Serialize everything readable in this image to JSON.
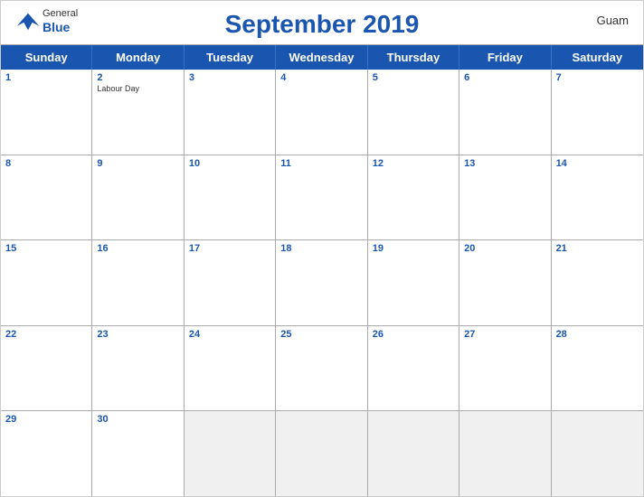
{
  "header": {
    "title": "September 2019",
    "region": "Guam",
    "logo_general": "General",
    "logo_blue": "Blue"
  },
  "day_headers": [
    "Sunday",
    "Monday",
    "Tuesday",
    "Wednesday",
    "Thursday",
    "Friday",
    "Saturday"
  ],
  "weeks": [
    [
      {
        "num": "1",
        "holiday": ""
      },
      {
        "num": "2",
        "holiday": "Labour Day"
      },
      {
        "num": "3",
        "holiday": ""
      },
      {
        "num": "4",
        "holiday": ""
      },
      {
        "num": "5",
        "holiday": ""
      },
      {
        "num": "6",
        "holiday": ""
      },
      {
        "num": "7",
        "holiday": ""
      }
    ],
    [
      {
        "num": "8",
        "holiday": ""
      },
      {
        "num": "9",
        "holiday": ""
      },
      {
        "num": "10",
        "holiday": ""
      },
      {
        "num": "11",
        "holiday": ""
      },
      {
        "num": "12",
        "holiday": ""
      },
      {
        "num": "13",
        "holiday": ""
      },
      {
        "num": "14",
        "holiday": ""
      }
    ],
    [
      {
        "num": "15",
        "holiday": ""
      },
      {
        "num": "16",
        "holiday": ""
      },
      {
        "num": "17",
        "holiday": ""
      },
      {
        "num": "18",
        "holiday": ""
      },
      {
        "num": "19",
        "holiday": ""
      },
      {
        "num": "20",
        "holiday": ""
      },
      {
        "num": "21",
        "holiday": ""
      }
    ],
    [
      {
        "num": "22",
        "holiday": ""
      },
      {
        "num": "23",
        "holiday": ""
      },
      {
        "num": "24",
        "holiday": ""
      },
      {
        "num": "25",
        "holiday": ""
      },
      {
        "num": "26",
        "holiday": ""
      },
      {
        "num": "27",
        "holiday": ""
      },
      {
        "num": "28",
        "holiday": ""
      }
    ],
    [
      {
        "num": "29",
        "holiday": ""
      },
      {
        "num": "30",
        "holiday": ""
      },
      {
        "num": "",
        "holiday": ""
      },
      {
        "num": "",
        "holiday": ""
      },
      {
        "num": "",
        "holiday": ""
      },
      {
        "num": "",
        "holiday": ""
      },
      {
        "num": "",
        "holiday": ""
      }
    ]
  ],
  "colors": {
    "primary_blue": "#1a56b0",
    "header_bg": "#1a56b0",
    "cell_bg": "#ffffff",
    "border": "#aaaaaa"
  }
}
